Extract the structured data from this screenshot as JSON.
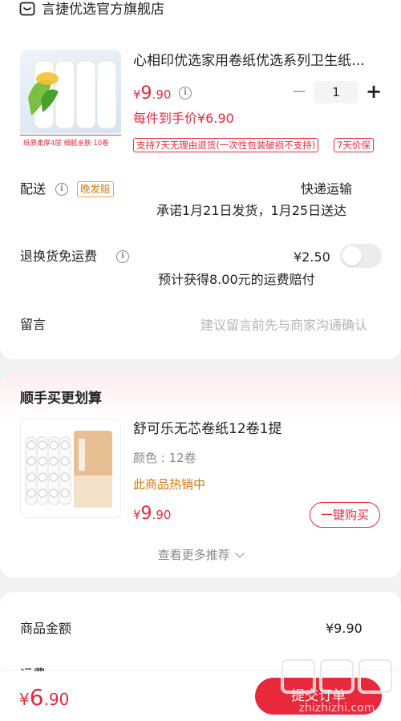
{
  "store": {
    "icon": "store-icon",
    "name": "言捷优选官方旗舰店"
  },
  "product": {
    "image_alt_text": "纸质柔厚4层 细腻亲肤 10卷",
    "title": "心相印优选家用卷纸优选系列卫生纸…",
    "price_symbol": "¥",
    "price_int": "9",
    "price_dec": ".90",
    "quantity": "1",
    "minus": "−",
    "plus": "+",
    "each_price": "每件到手价¥6.90",
    "tag_return": "支持7天无理由退货(一次性包装破损不支持)",
    "tag_price": "7天价保"
  },
  "delivery": {
    "label": "配送",
    "badge": "晚发赔",
    "method": "快递运输",
    "promise": "承诺1月21日发货，1月25日送达"
  },
  "freight": {
    "label": "退换货免运费",
    "price": "¥2.50",
    "note": "预计获得8.00元的运费赔付",
    "toggle_on": false
  },
  "message": {
    "label": "留言",
    "placeholder": "建议留言前先与商家沟通确认"
  },
  "recommend": {
    "title": "顺手买更划算",
    "item_title": "舒可乐无芯卷纸12卷1提",
    "item_spec": "颜色 : 12卷",
    "item_hot": "此商品热销中",
    "price_symbol": "¥",
    "price_int": "9",
    "price_dec": ".90",
    "buy_button": "一键购买",
    "more": "查看更多推荐",
    "more_icon": "chevron-down-icon"
  },
  "summary": {
    "label": "商品金额",
    "value": "¥9.90",
    "next_label_partial": "运费"
  },
  "bottom": {
    "total_symbol": "¥",
    "total_int": "6",
    "total_dec": ".90",
    "submit": "提交订单",
    "watermark": "值 什么值得买 zhizhizhi.com"
  },
  "colors": {
    "accent": "#e8293b",
    "bg": "#f2f2f2"
  }
}
